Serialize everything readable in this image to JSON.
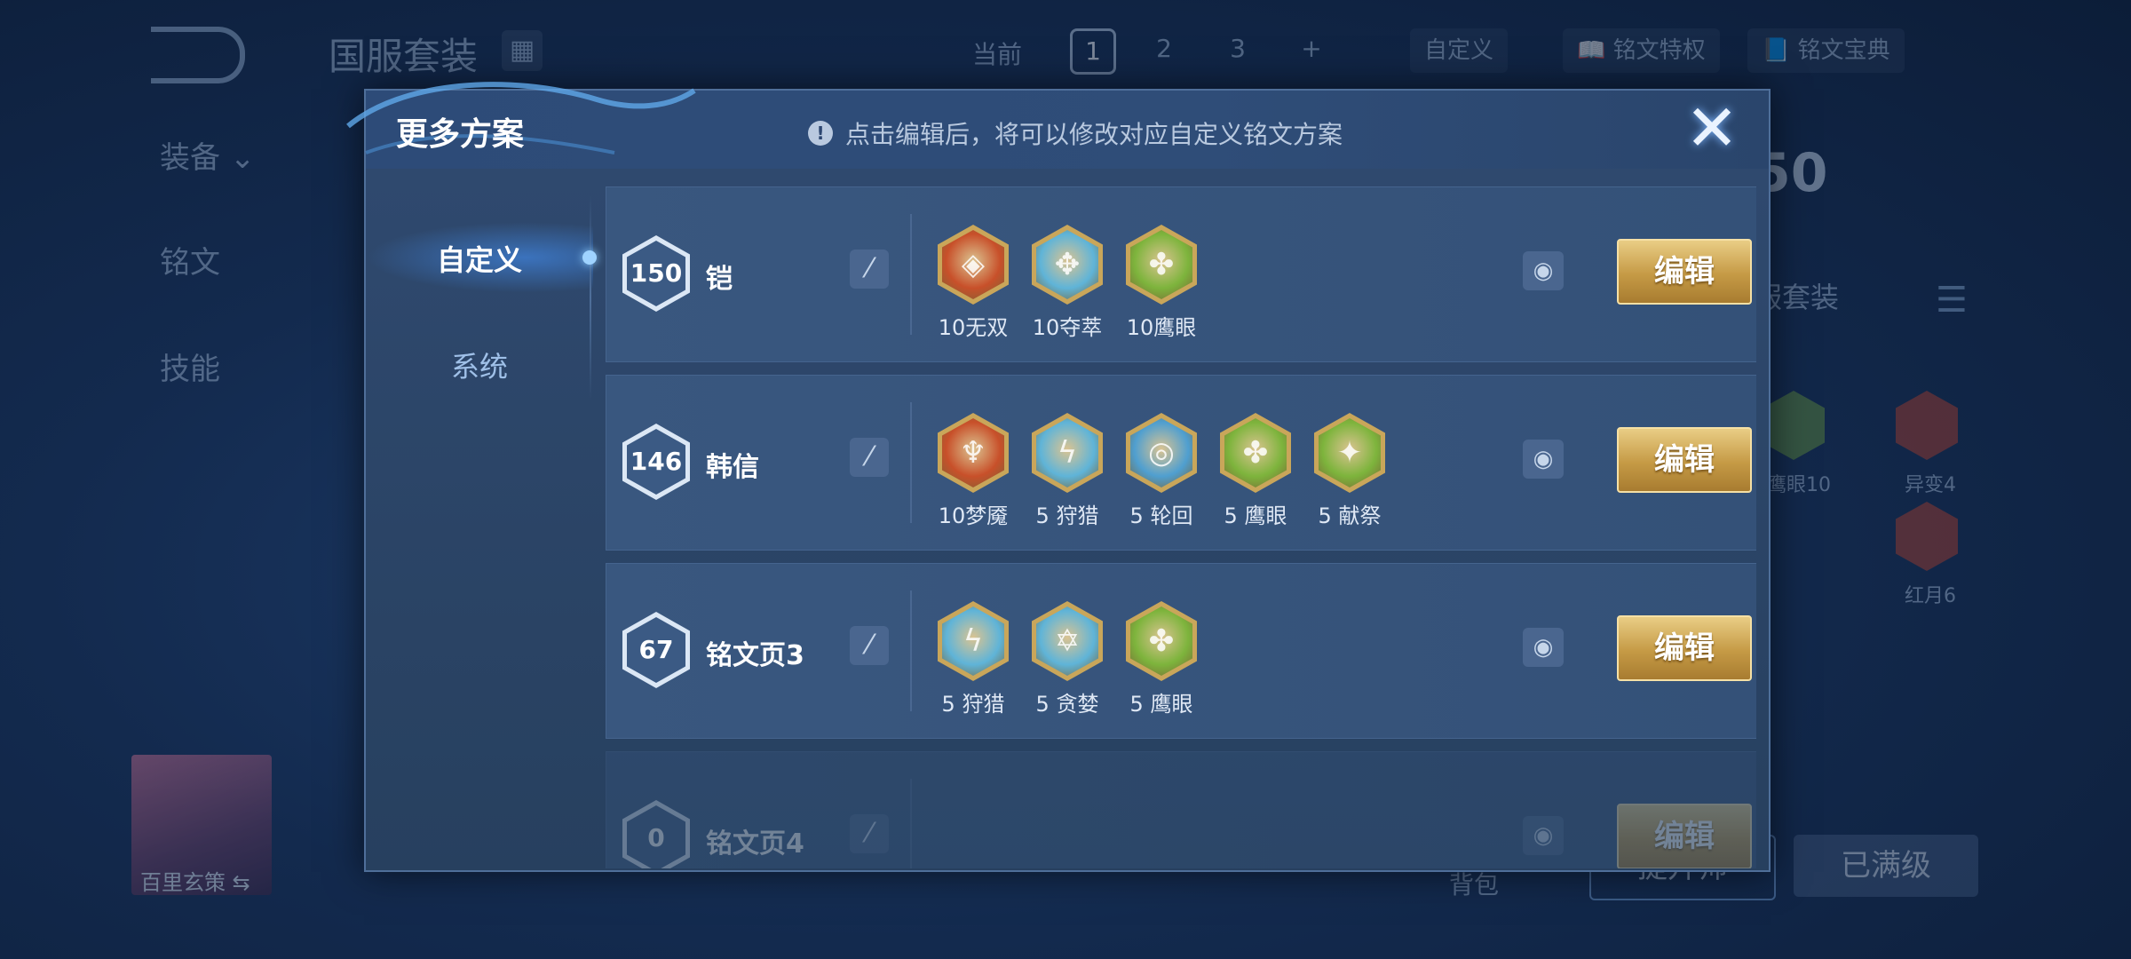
{
  "background": {
    "title": "国服套装",
    "current_label": "当前",
    "pages": [
      "1",
      "2",
      "3",
      "+"
    ],
    "active_page": "1",
    "custom_label": "自定义",
    "privilege_label": "铭文特权",
    "codex_label": "铭文宝典",
    "side_items": [
      "装备",
      "铭文",
      "技能"
    ],
    "right_level": "50",
    "right_label": "服套装",
    "rune_labels": [
      "鹰眼10",
      "异变4",
      "红月6"
    ],
    "hero_name": "百里玄策",
    "bag_label": "背包",
    "upgrade_label": "提升师",
    "maxed_label": "已满级"
  },
  "modal": {
    "title": "更多方案",
    "hint": "点击编辑后，将可以修改对应自定义铭文方案",
    "tabs": [
      {
        "label": "自定义",
        "active": true
      },
      {
        "label": "系统",
        "active": false
      }
    ],
    "edit_label": "编辑",
    "presets": [
      {
        "level": "150",
        "name": "铠",
        "runes": [
          {
            "label": "10无双",
            "color": "#c8502a",
            "icon": "flame-rune"
          },
          {
            "label": "10夺萃",
            "color": "#5fb4d8",
            "icon": "knot-rune"
          },
          {
            "label": "10鹰眼",
            "color": "#7db43c",
            "icon": "clover-rune"
          }
        ]
      },
      {
        "level": "146",
        "name": "韩信",
        "runes": [
          {
            "label": "10梦魇",
            "color": "#c8502a",
            "icon": "fire-rune"
          },
          {
            "label": "5 狩猎",
            "color": "#5fb4d8",
            "icon": "lightning-rune"
          },
          {
            "label": "5 轮回",
            "color": "#4f9fd0",
            "icon": "swirl-rune"
          },
          {
            "label": "5 鹰眼",
            "color": "#7db43c",
            "icon": "clover-rune"
          },
          {
            "label": "5 献祭",
            "color": "#7db43c",
            "icon": "leaf-rune"
          }
        ]
      },
      {
        "level": "67",
        "name": "铭文页3",
        "runes": [
          {
            "label": "5 狩猎",
            "color": "#5fb4d8",
            "icon": "lightning-rune"
          },
          {
            "label": "5 贪婪",
            "color": "#5fb4d8",
            "icon": "star-rune"
          },
          {
            "label": "5 鹰眼",
            "color": "#7db43c",
            "icon": "clover-rune"
          }
        ]
      },
      {
        "level": "0",
        "name": "铭文页4",
        "runes": []
      }
    ]
  }
}
